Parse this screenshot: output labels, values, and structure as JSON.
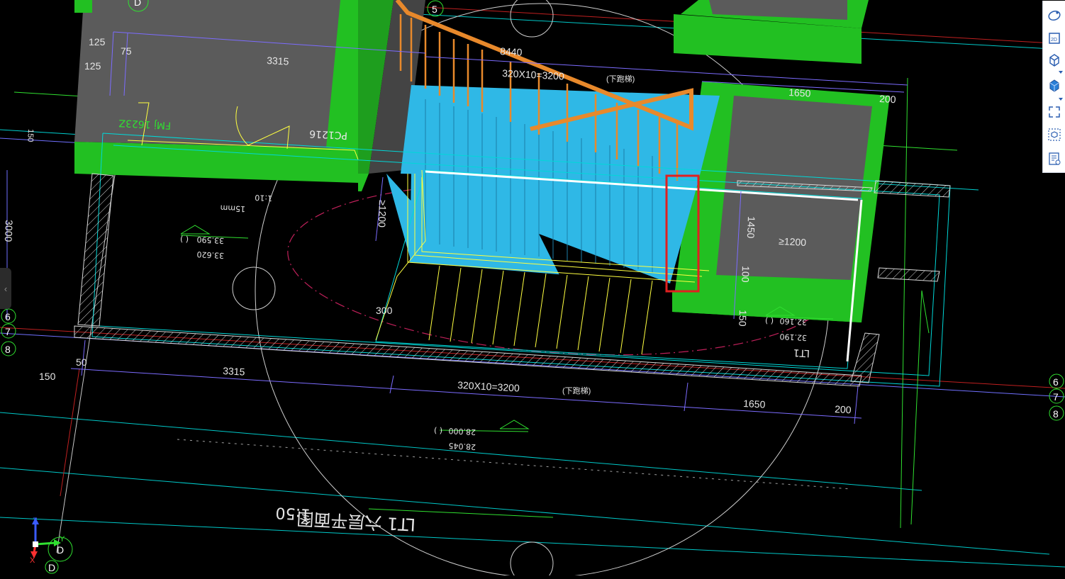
{
  "dimensions": {
    "d125a": "125",
    "d75": "75",
    "d125b": "125",
    "d3315_top": "3315",
    "d8440": "8440",
    "d_stair_top": "320X10=3200",
    "d1650_top": "1650",
    "d200_top": "200",
    "d150_left": "150",
    "d3000": "3000",
    "d1200_mid": "≥1200",
    "d1450": "1450",
    "d1200_right": "≥1200",
    "d100": "100",
    "d150_right": "150",
    "d300": "300",
    "d50": "50",
    "d150_bottom": "150",
    "d3315_bottom": "3315",
    "d_stair_bottom": "320X10=3200",
    "d1650_bottom": "1650",
    "d200_bottom": "200"
  },
  "labels": {
    "door_fm": "FMj 1623Z",
    "window_pc": "PC1216",
    "elev1a": "33.590",
    "elev1b": "33.620",
    "elev1_note": "(  )",
    "elev2a": "32.160",
    "elev2b": "32.190",
    "elev2_note": "(  )",
    "elev3a": "28.000",
    "elev3b": "28.045",
    "elev3_note": "(  )",
    "stair_id": "LT1",
    "note_110": "1:10",
    "note_15mm": "15mm",
    "stair_title": "LT1 六层平面图",
    "scale": "1:50",
    "up_small_top": "(下跑梯)",
    "up_small_bottom": "(下跑梯)"
  },
  "grid_axes": {
    "top_5": "5",
    "left_6": "6",
    "left_7": "7",
    "left_8": "8",
    "right_6": "6",
    "right_7": "7",
    "right_8": "8",
    "axis_d_top": "D",
    "axis_d_bottom": "D"
  },
  "ucs": {
    "z": "Z",
    "y": "Y",
    "x": "X"
  },
  "toolbar": {
    "items": [
      {
        "icon": "orbit-icon"
      },
      {
        "icon": "view-2d-icon",
        "label": "2D"
      },
      {
        "icon": "view-3d-box-icon"
      },
      {
        "icon": "solid-box-icon"
      },
      {
        "icon": "fullscreen-icon"
      },
      {
        "icon": "cube-view-icon"
      },
      {
        "icon": "properties-list-icon"
      }
    ]
  },
  "colors": {
    "slab": "#22c022",
    "stair": "#2fb8e6",
    "railing": "#e8892b",
    "wall_top": "#5a5a5a",
    "highlight": "#e02020",
    "cyan_line": "#00e0e0",
    "yellow_line": "#ffff40"
  }
}
